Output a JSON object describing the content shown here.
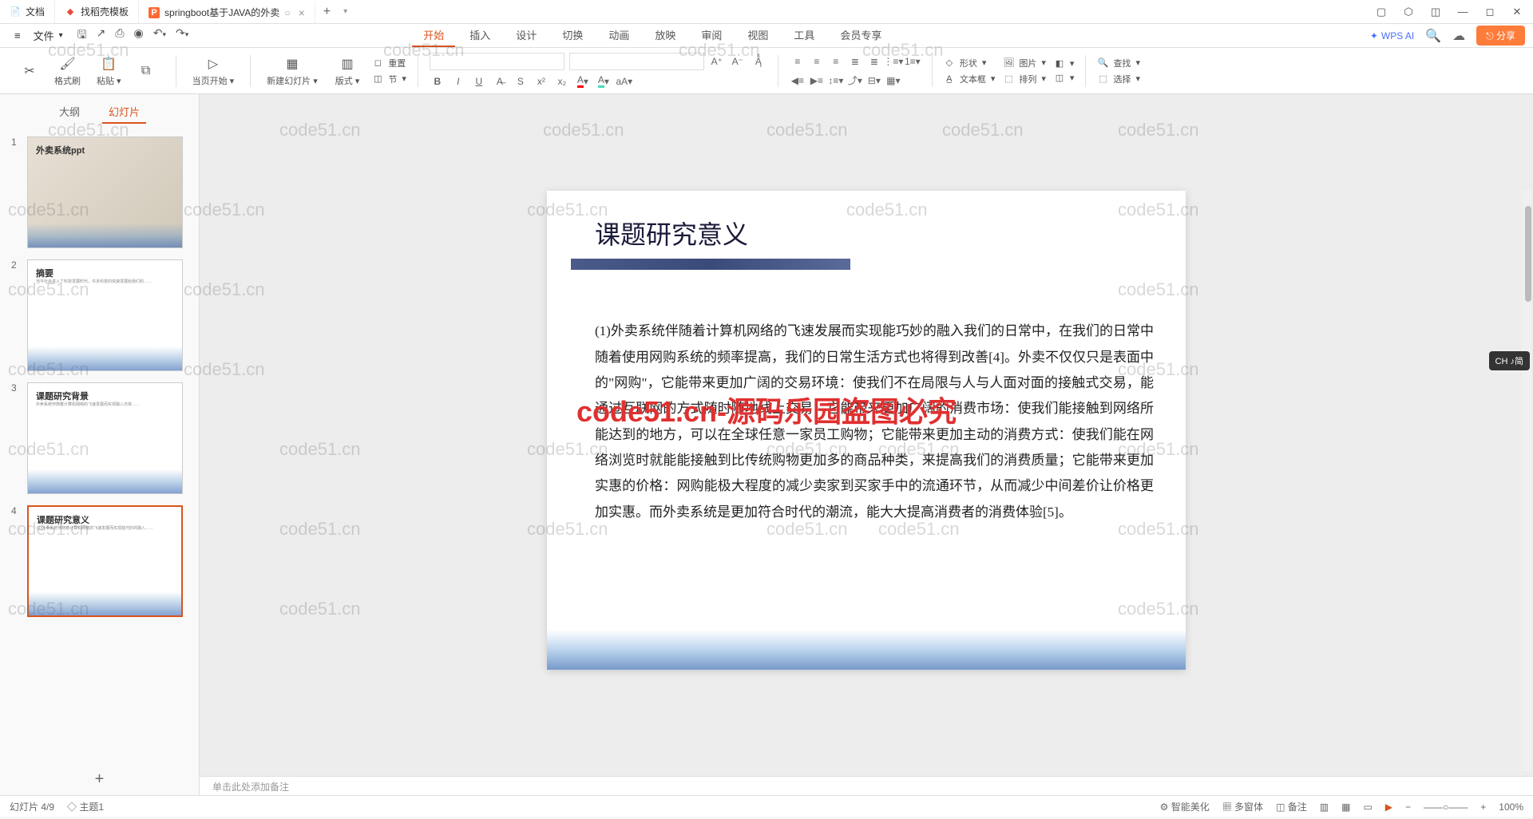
{
  "tabs": [
    {
      "icon": "📄",
      "iconColor": "#4a90e2",
      "label": "文档"
    },
    {
      "icon": "◆",
      "iconColor": "#e74c3c",
      "label": "找稻壳模板"
    },
    {
      "icon": "P",
      "iconColor": "#ff6b35",
      "label": "springboot基于JAVA的外卖",
      "active": true,
      "hasClose": true
    }
  ],
  "fileMenu": "文件",
  "menuTabs": [
    "开始",
    "插入",
    "设计",
    "切换",
    "动画",
    "放映",
    "审阅",
    "视图",
    "工具",
    "会员专享"
  ],
  "activeMenuTab": "开始",
  "wpsAI": "WPS AI",
  "shareBtn": "分享",
  "ribbon": {
    "formatPainter": "格式刷",
    "paste": "粘贴",
    "startFromCurrent": "当页开始",
    "newSlide": "新建幻灯片",
    "layout": "版式",
    "reset": "重置",
    "section": "节",
    "shape": "形状",
    "picture": "图片",
    "textbox": "文本框",
    "arrange": "排列",
    "find": "查找",
    "select": "选择"
  },
  "sidebarTabs": [
    "大纲",
    "幻灯片"
  ],
  "activeSidebarTab": "幻灯片",
  "thumbnails": [
    {
      "num": "1",
      "title": "外卖系统ppt",
      "type": "image"
    },
    {
      "num": "2",
      "title": "摘要",
      "type": "text"
    },
    {
      "num": "3",
      "title": "课题研究背景",
      "type": "text"
    },
    {
      "num": "4",
      "title": "课题研究意义",
      "type": "text",
      "selected": true
    }
  ],
  "slide": {
    "title": "课题研究意义",
    "body": "(1)外卖系统伴随着计算机网络的飞速发展而实现能巧妙的融入我们的日常中，在我们的日常中随着使用网购系统的频率提高，我们的日常生活方式也将得到改善[4]。外卖不仅仅只是表面中的\"网购\"，它能带来更加广阔的交易环境：使我们不在局限与人与人面对面的接触式交易，能通过互联网的方式随时随地线上交易；它能带来更加广阔的消费市场：使我们能接触到网络所能达到的地方，可以在全球任意一家员工购物；它能带来更加主动的消费方式：使我们能在网络浏览时就能能接触到比传统购物更加多的商品种类，来提高我们的消费质量；它能带来更加实惠的价格：网购能极大程度的减少卖家到买家手中的流通环节，从而减少中间差价让价格更加实惠。而外卖系统是更加符合时代的潮流，能大大提高消费者的消费体验[5]。"
  },
  "notesPlaceholder": "单击此处添加备注",
  "status": {
    "slideInfo": "幻灯片 4/9",
    "theme": "主题1",
    "smartBeautify": "智能美化",
    "multiWindow": "多窗体",
    "notes": "备注",
    "zoom": "100%"
  },
  "watermarkText": "code51.cn",
  "watermarkRed": "code51.cn-源码乐园盗图必究",
  "imeBadge": "CH ♪简"
}
